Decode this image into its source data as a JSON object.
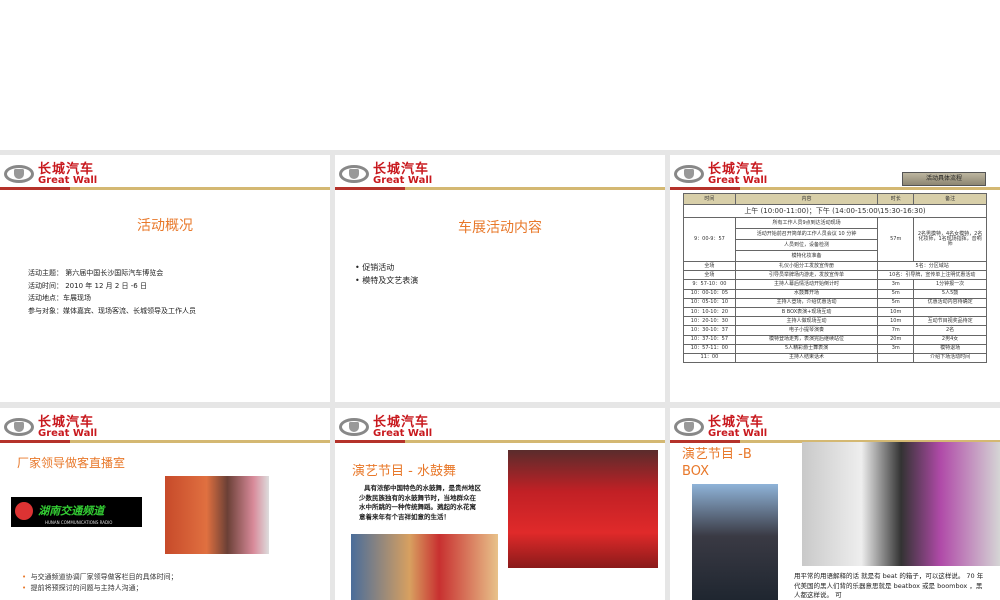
{
  "logo": {
    "cn": "长城汽车",
    "en": "Great Wall"
  },
  "slide1": {
    "title": "活动概况",
    "lines": [
      "活动主题： 第六届中国长沙国际汽车博览会",
      "活动时间： 2010 年 12 月 2 日 -6 日",
      "活动地点：车展现场",
      "参与对象：媒体嘉宾、现场客流、长城领导及工作人员"
    ]
  },
  "slide2": {
    "title": "车展活动内容",
    "bullets": [
      "促销活动",
      "模特及文艺表演"
    ]
  },
  "slide3": {
    "tag": "活动具体流程",
    "headers": [
      "时间",
      "内容",
      "时长",
      "备注"
    ],
    "session": "上午 (10:00-11:00)；下午 (14:00-15:00\\15:30-16:30)",
    "block": {
      "time": "9：00-9：57",
      "items": [
        "所有工作人员9点到达活动现场",
        "活动开始前召开简单的工作人员会议 10 分钟",
        "人员到位，设备检测",
        "模特化妆准备"
      ],
      "duration": "57m",
      "note": "2名男模特，4名女模特，2名化妆师，1名现场指挥，音响师"
    },
    "rows": [
      [
        "全场",
        "礼仪小姐分工发放宣传册",
        "5名：分区域站",
        ""
      ],
      [
        "全场",
        "引导员举牌场内游走，发放宣传单",
        "10名：引导牌，宣传单上注明优惠活动",
        ""
      ],
      [
        "9：57-10：00",
        "主持人幕后情活动开始倒计时",
        "3m",
        "1分钟报一次"
      ],
      [
        "10：00-10：05",
        "水鼓舞开场",
        "5m",
        "5人5鼓"
      ],
      [
        "10：05-10：10",
        "主持人登场，介绍优惠活动",
        "5m",
        "优惠活动内容待确定"
      ],
      [
        "10：10-10：20",
        "B BOX表演+现场互动",
        "10m",
        ""
      ],
      [
        "10：20-10：30",
        "主持人做现场互动",
        "10m",
        "互动节目视奖品待定"
      ],
      [
        "10：30-10：37",
        "电子小提琴演奏",
        "7m",
        "2名"
      ],
      [
        "10：37-10：57",
        "模特登场走秀，表演完后继续站位",
        "20m",
        "2男4女"
      ],
      [
        "10：57-11：00",
        "5人精彩爵士舞表演",
        "3m",
        "模特退场"
      ],
      [
        "11：00",
        "主持人结束话术",
        "",
        "介绍下场活动时间"
      ]
    ]
  },
  "slide4": {
    "title": "厂家领导做客直播室",
    "radio_cn": "湖南交通频道",
    "radio_en": "HUNAN COMMUNICATIONS RADIO",
    "bullets": [
      "与交通频道协调厂家领导做客栏目的具体时间；",
      "提前将预探讨的问题与主持人沟通；"
    ]
  },
  "slide5": {
    "title": "演艺节目 - 水鼓舞",
    "text": "具有浓郁中国特色的水鼓舞，是贵州地区少数民族独有的水鼓舞节时，当地群众在水中所跳的一种传统舞蹈。溅起的水花寓意着来年有个吉祥如意的生活！"
  },
  "slide6": {
    "title": "演艺节目 -B BOX",
    "text": "用平常的用语解释的话 就是有 beat 的箱子，可以这样说。 70 年代美国的黑人们背的乐器意思就是 beatbox 或是 boombox ，黑人都这样说。 可"
  }
}
